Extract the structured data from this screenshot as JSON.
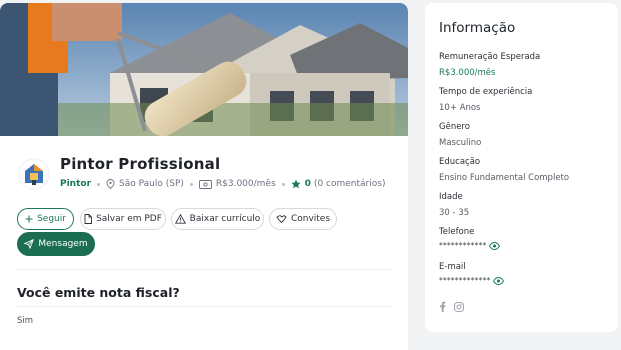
{
  "profile": {
    "name": "Pintor Profissional",
    "role": "Pintor",
    "location": "São Paulo (SP)",
    "salary": "R$3.000/mês",
    "rating": "0",
    "comments": "(0 comentários)"
  },
  "actions": {
    "follow": "Seguir",
    "save_pdf": "Salvar em PDF",
    "download_cv": "Baixar currículo",
    "invites": "Convites",
    "message": "Mensagem"
  },
  "question": {
    "title": "Você emite nota fiscal?",
    "answer": "Sim"
  },
  "sidebar": {
    "title": "Informação",
    "items": [
      {
        "label": "Remuneração Esperada",
        "value": "R$3.000/mês"
      },
      {
        "label": "Tempo de experiência",
        "value": "10+ Anos"
      },
      {
        "label": "Gênero",
        "value": "Masculino"
      },
      {
        "label": "Educação",
        "value": "Ensino Fundamental Completo"
      },
      {
        "label": "Idade",
        "value": "30 - 35"
      },
      {
        "label": "Telefone",
        "value": "************"
      },
      {
        "label": "E-mail",
        "value": "*************"
      }
    ]
  },
  "colors": {
    "accent": "#1b6e52",
    "accent_text": "#177a5a",
    "background": "#f2f3f4"
  },
  "icons": {
    "facebook": "facebook-icon",
    "instagram": "instagram-icon",
    "eye": "eye-icon"
  }
}
